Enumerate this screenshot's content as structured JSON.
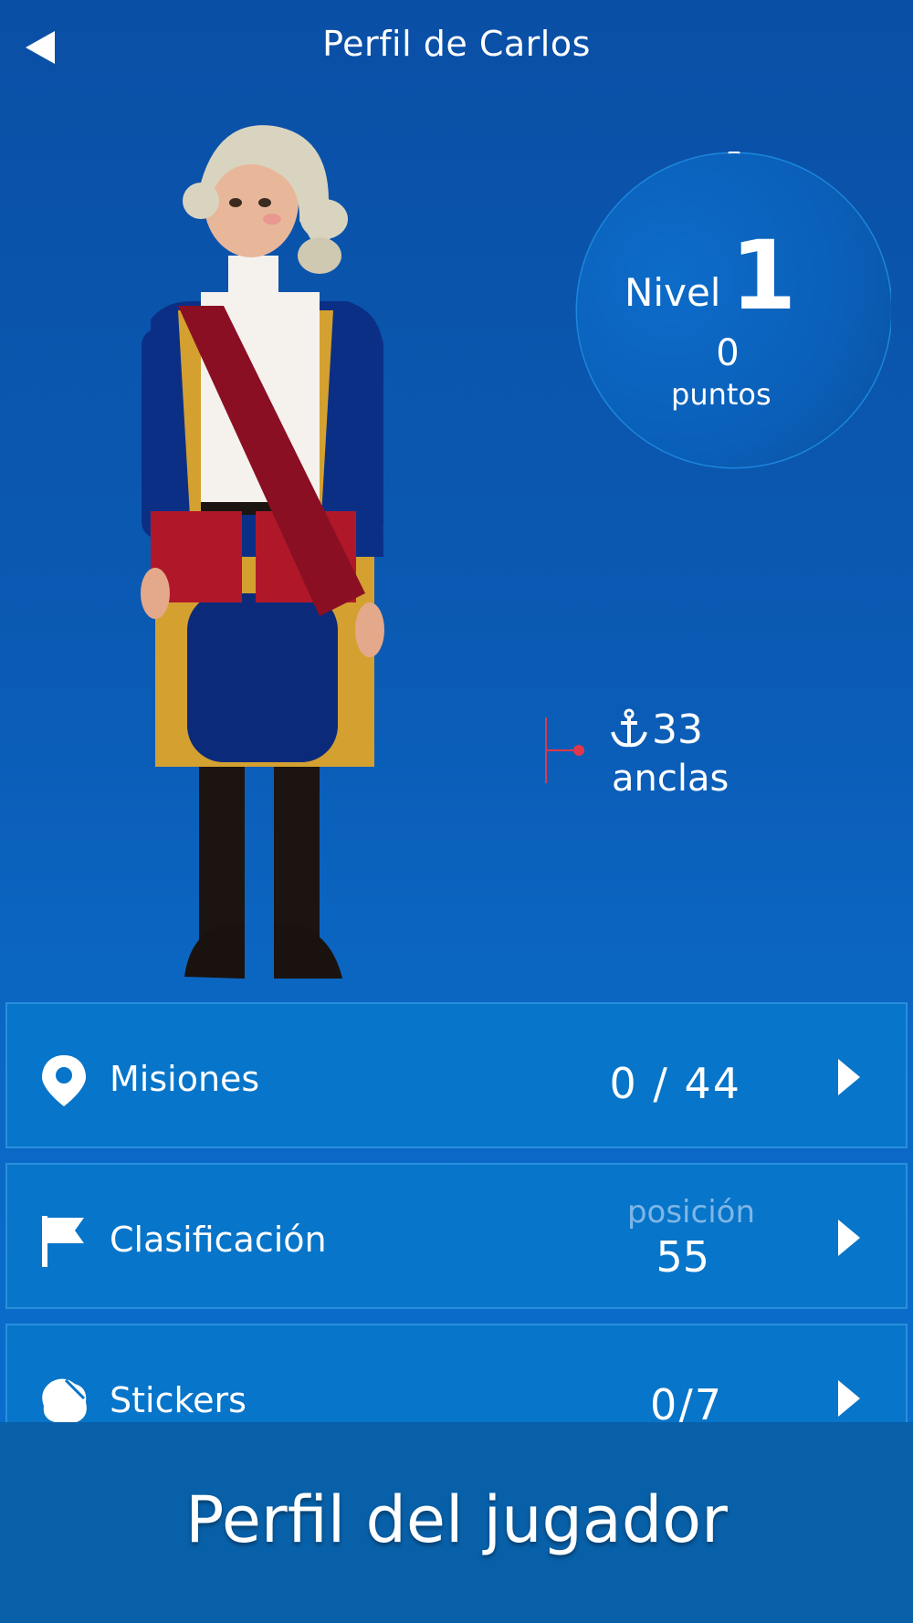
{
  "header": {
    "title": "Perfil de Carlos"
  },
  "level": {
    "label": "Nivel",
    "value": "1",
    "points_value": "0",
    "points_label": "puntos"
  },
  "anchors": {
    "value": "33",
    "label": "anclas"
  },
  "rows": [
    {
      "label": "Misiones",
      "value": "0 / 44",
      "icon": "location-pin-icon"
    },
    {
      "label": "Clasificación",
      "sublabel": "posición",
      "value": "55",
      "icon": "flag-icon"
    },
    {
      "label": "Stickers",
      "value": "0/7",
      "icon": "sticker-badge-icon"
    }
  ],
  "footer": {
    "caption": "Perfil del jugador"
  },
  "colors": {
    "background_top": "#0a4fa6",
    "row_bg": "#0775c9",
    "footer_bg": "#0860a8",
    "accent_red": "#e0384a"
  }
}
